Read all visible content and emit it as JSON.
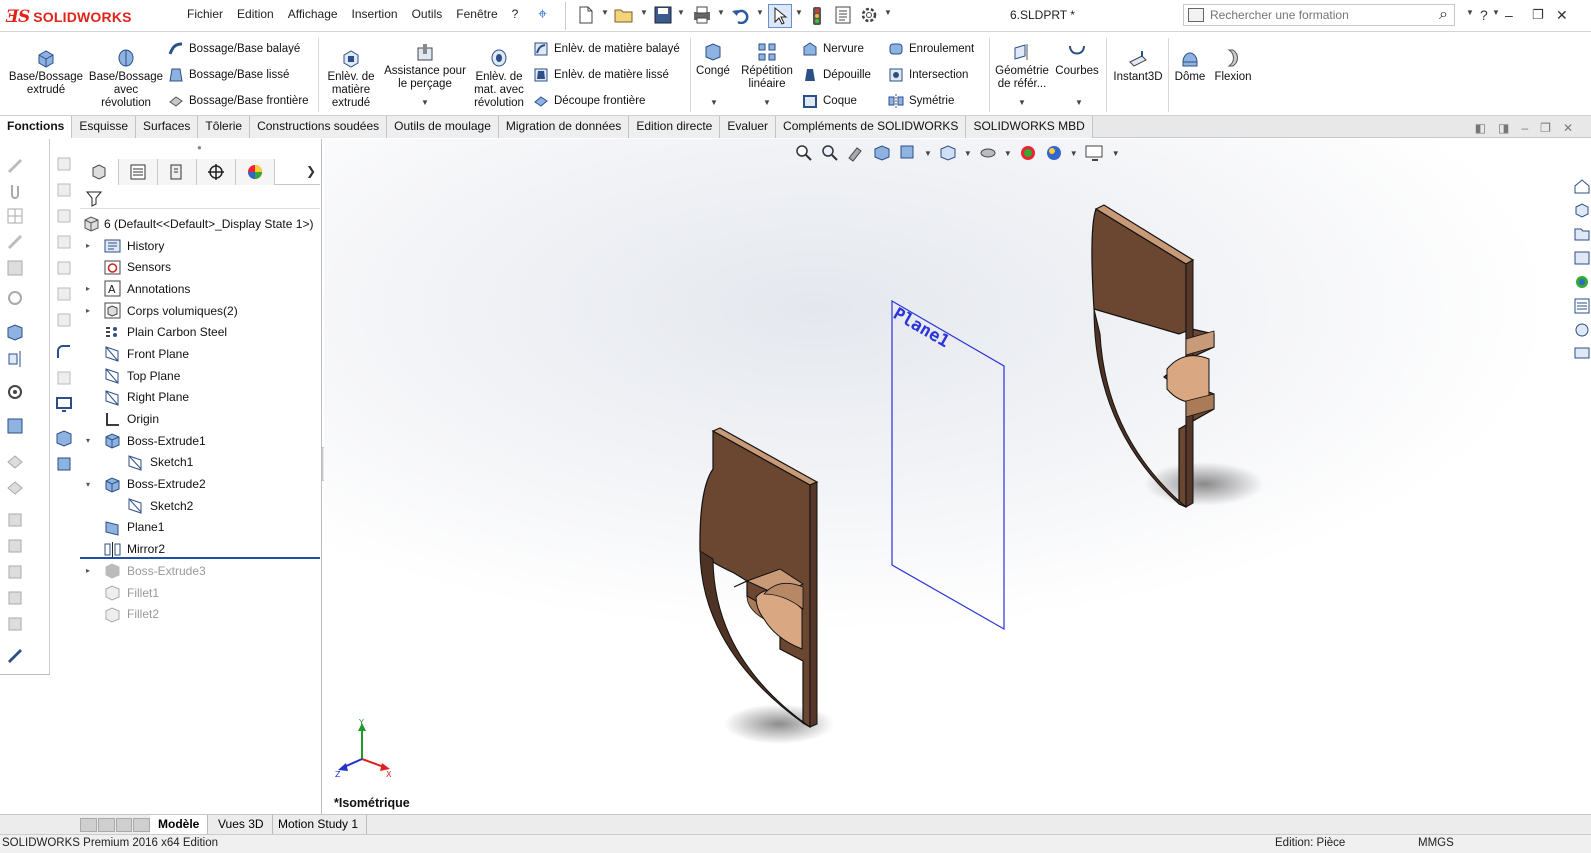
{
  "app": {
    "logo_ds": "ƎS",
    "logo_brand": "SOLIDWORKS",
    "doc_title": "6.SLDPRT *"
  },
  "menu": [
    "Fichier",
    "Edition",
    "Affichage",
    "Insertion",
    "Outils",
    "Fenêtre",
    "?"
  ],
  "search": {
    "placeholder": "Rechercher une formation"
  },
  "ribbon": {
    "base_bossage": "Base/Bossage\nextrudé",
    "base_revolution": "Base/Bossage\navec\nrévolution",
    "bossage_balaye": "Bossage/Base balayé",
    "bossage_lisse": "Bossage/Base lissé",
    "bossage_frontiere": "Bossage/Base frontière",
    "enlev_extrude": "Enlèv. de\nmatière\nextrudé",
    "assistance_percage": "Assistance pour\nle perçage",
    "enlev_revolution": "Enlèv. de\nmat. avec\nrévolution",
    "enlev_balaye": "Enlèv. de matière balayé",
    "enlev_lisse": "Enlèv. de matière lissé",
    "decoupe_frontiere": "Découpe frontière",
    "conge": "Congé",
    "repetition_lineaire": "Répétition\nlinéaire",
    "nervure": "Nervure",
    "depouille": "Dépouille",
    "coque": "Coque",
    "enroulement": "Enroulement",
    "intersection": "Intersection",
    "symetrie": "Symétrie",
    "geometrie_ref": "Géométrie\nde référ...",
    "courbes": "Courbes",
    "instant3d": "Instant3D",
    "dome": "Dôme",
    "flexion": "Flexion"
  },
  "tabs": [
    "Fonctions",
    "Esquisse",
    "Surfaces",
    "Tôlerie",
    "Constructions soudées",
    "Outils de moulage",
    "Migration de données",
    "Edition directe",
    "Evaluer",
    "Compléments de SOLIDWORKS",
    "SOLIDWORKS MBD"
  ],
  "tree": {
    "root": "6  (Default<<Default>_Display State 1>)",
    "items": [
      {
        "label": "History",
        "icon": "history-folder-icon",
        "expand": "▸",
        "indent": 0,
        "dim": false
      },
      {
        "label": "Sensors",
        "icon": "sensors-icon",
        "expand": "",
        "indent": 0,
        "dim": false
      },
      {
        "label": "Annotations",
        "icon": "annotations-icon",
        "expand": "▸",
        "indent": 0,
        "dim": false
      },
      {
        "label": "Corps volumiques(2)",
        "icon": "solid-bodies-icon",
        "expand": "▸",
        "indent": 0,
        "dim": false
      },
      {
        "label": "Plain Carbon Steel",
        "icon": "material-icon",
        "expand": "",
        "indent": 0,
        "dim": false
      },
      {
        "label": "Front Plane",
        "icon": "plane-icon",
        "expand": "",
        "indent": 0,
        "dim": false
      },
      {
        "label": "Top Plane",
        "icon": "plane-icon",
        "expand": "",
        "indent": 0,
        "dim": false
      },
      {
        "label": "Right Plane",
        "icon": "plane-icon",
        "expand": "",
        "indent": 0,
        "dim": false
      },
      {
        "label": "Origin",
        "icon": "origin-icon",
        "expand": "",
        "indent": 0,
        "dim": false
      },
      {
        "label": "Boss-Extrude1",
        "icon": "extrude-icon",
        "expand": "▾",
        "indent": 0,
        "dim": false
      },
      {
        "label": "Sketch1",
        "icon": "sketch-icon",
        "expand": "",
        "indent": 1,
        "dim": false
      },
      {
        "label": "Boss-Extrude2",
        "icon": "extrude-icon",
        "expand": "▾",
        "indent": 0,
        "dim": false
      },
      {
        "label": "Sketch2",
        "icon": "sketch-icon",
        "expand": "",
        "indent": 1,
        "dim": false
      },
      {
        "label": "Plane1",
        "icon": "ref-plane-icon",
        "expand": "",
        "indent": 0,
        "dim": false
      },
      {
        "label": "Mirror2",
        "icon": "mirror-icon",
        "expand": "",
        "indent": 0,
        "dim": false
      },
      {
        "label": "Boss-Extrude3",
        "icon": "extrude-icon",
        "expand": "▸",
        "indent": 0,
        "dim": true
      },
      {
        "label": "Fillet1",
        "icon": "fillet-icon",
        "expand": "",
        "indent": 0,
        "dim": true
      },
      {
        "label": "Fillet2",
        "icon": "fillet-icon",
        "expand": "",
        "indent": 0,
        "dim": true
      }
    ]
  },
  "viewport": {
    "plane_label": "Plane1",
    "view_name": "*Isométrique",
    "triad": {
      "x": "X",
      "y": "Y",
      "z": "Z"
    },
    "part_color": "#6e4a35",
    "plane_color": "#2b33d9"
  },
  "bottom_tabs": [
    "Modèle",
    "Vues 3D",
    "Motion Study 1"
  ],
  "status": {
    "left": "SOLIDWORKS Premium 2016 x64 Edition",
    "mode": "Edition: Pièce",
    "units": "MMGS"
  }
}
